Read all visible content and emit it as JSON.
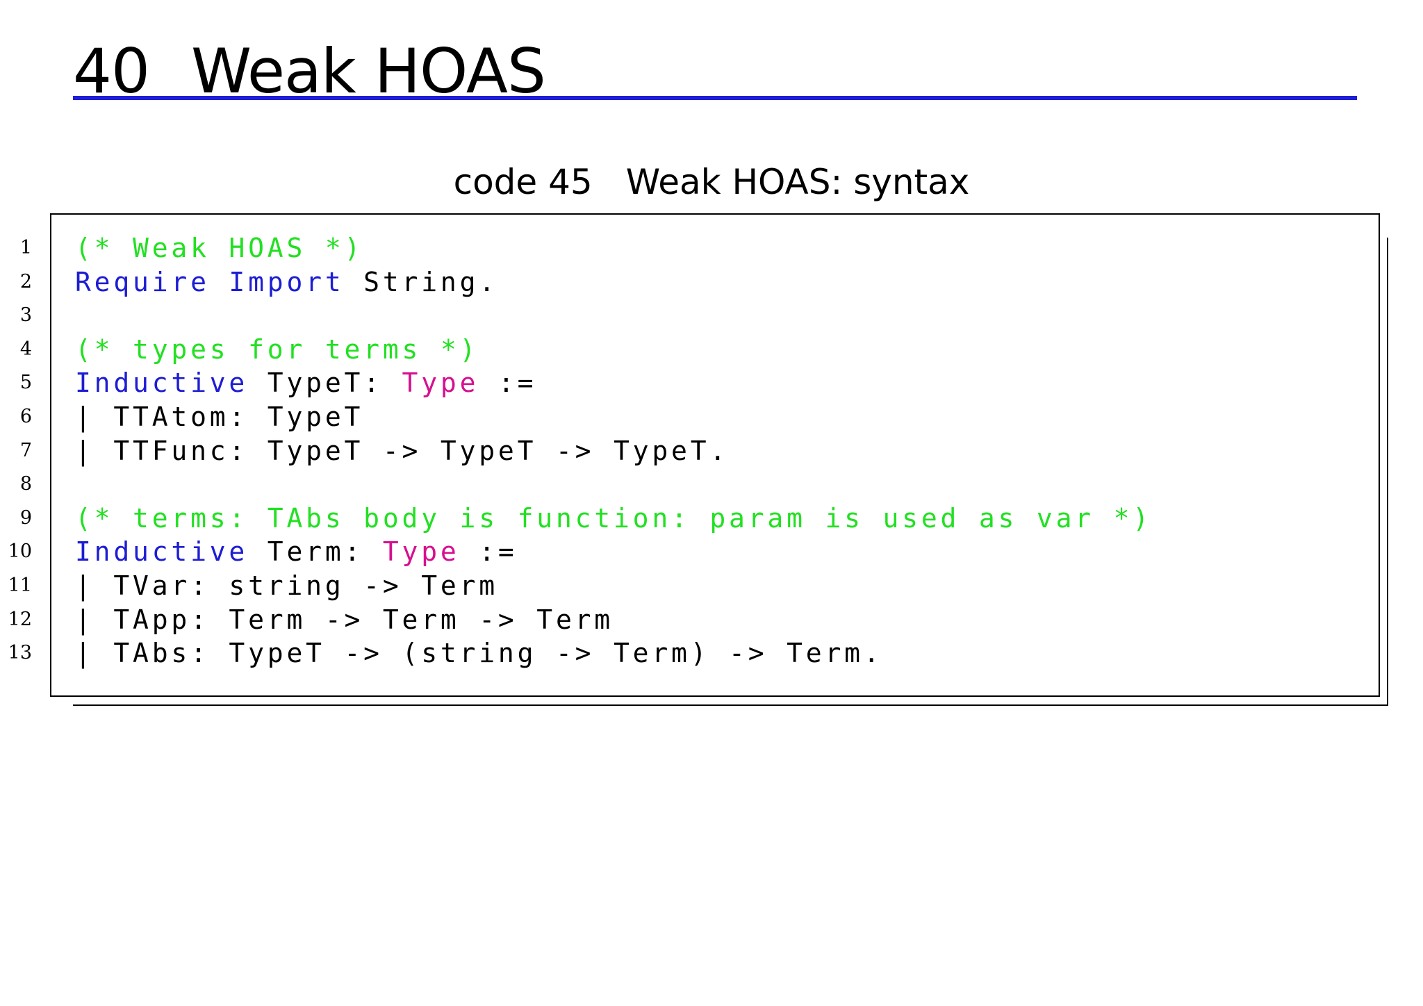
{
  "section": {
    "number": "40",
    "title": "Weak HOAS"
  },
  "caption": {
    "number": "code 45",
    "title": "Weak HOAS: syntax"
  },
  "code": {
    "line_numbers": [
      "1",
      "2",
      "3",
      "4",
      "5",
      "6",
      "7",
      "8",
      "9",
      "10",
      "11",
      "12",
      "13"
    ],
    "lines": [
      [
        {
          "t": "(* Weak HOAS *)",
          "k": "comment"
        }
      ],
      [
        {
          "t": "Require Import",
          "k": "keyword"
        },
        {
          "t": " String.",
          "k": "text"
        }
      ],
      [],
      [
        {
          "t": "(* types for terms *)",
          "k": "comment"
        }
      ],
      [
        {
          "t": "Inductive",
          "k": "keyword"
        },
        {
          "t": " TypeT: ",
          "k": "text"
        },
        {
          "t": "Type",
          "k": "type"
        },
        {
          "t": " :=",
          "k": "text"
        }
      ],
      [
        {
          "t": "| TTAtom: TypeT",
          "k": "text"
        }
      ],
      [
        {
          "t": "| TTFunc: TypeT -> TypeT -> TypeT.",
          "k": "text"
        }
      ],
      [],
      [
        {
          "t": "(* terms: TAbs body is function: param is used as var *)",
          "k": "comment"
        }
      ],
      [
        {
          "t": "Inductive",
          "k": "keyword"
        },
        {
          "t": " Term: ",
          "k": "text"
        },
        {
          "t": "Type",
          "k": "type"
        },
        {
          "t": " :=",
          "k": "text"
        }
      ],
      [
        {
          "t": "| TVar: string -> Term",
          "k": "text"
        }
      ],
      [
        {
          "t": "| TApp: Term -> Term -> Term",
          "k": "text"
        }
      ],
      [
        {
          "t": "| TAbs: TypeT -> (string -> Term) -> Term.",
          "k": "text"
        }
      ]
    ]
  },
  "colors": {
    "section_rule": "#1f1fd6",
    "comment": "#22e022",
    "keyword": "#1d1dd4",
    "type": "#d6108f",
    "text": "#000000"
  }
}
